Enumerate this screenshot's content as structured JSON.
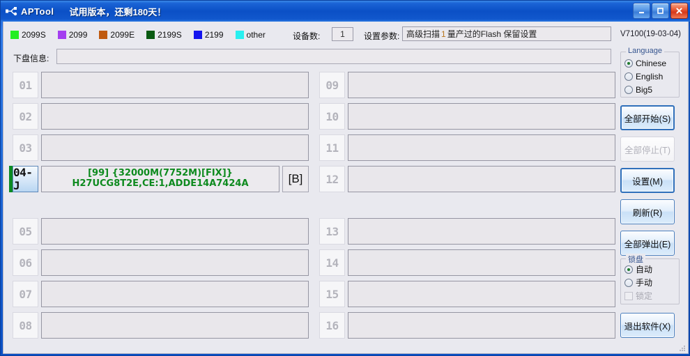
{
  "window": {
    "app_title": "APTool",
    "trial_notice": "试用版本，还剩180天！",
    "icon": "usb-device-icon",
    "buttons": {
      "minimize": "minimize-button",
      "maximize": "maximize-button",
      "close": "close-button"
    }
  },
  "legend": {
    "items": [
      {
        "label": "2099S",
        "color": "#22ee22"
      },
      {
        "label": "2099",
        "color": "#a43ef0"
      },
      {
        "label": "2099E",
        "color": "#c05a10"
      },
      {
        "label": "2199S",
        "color": "#0a5a12"
      },
      {
        "label": "2199",
        "color": "#1414ee"
      },
      {
        "label": "other",
        "color": "#28f0f0"
      }
    ]
  },
  "toolbar": {
    "device_count_label": "设备数:",
    "device_count_value": "1",
    "set_param_label": "设置参数:",
    "set_param_prefix": "高级扫描",
    "set_param_highlight": "1",
    "set_param_suffix": "量产过的Flash 保留设置",
    "version": "V7100(19-03-04)"
  },
  "info_row": {
    "label": "下盘信息:",
    "value": ""
  },
  "slots": [
    {
      "id": "01",
      "text1": "",
      "text2": "",
      "tag": "",
      "active": false
    },
    {
      "id": "02",
      "text1": "",
      "text2": "",
      "tag": "",
      "active": false
    },
    {
      "id": "03",
      "text1": "",
      "text2": "",
      "tag": "",
      "active": false
    },
    {
      "id": "04-J",
      "text1": "[99] {32000M(7752M)[FIX]}",
      "text2": "H27UCG8T2E,CE:1,ADDE14A7424A",
      "tag": "[B]",
      "active": true
    },
    {
      "id": "05",
      "text1": "",
      "text2": "",
      "tag": "",
      "active": false
    },
    {
      "id": "06",
      "text1": "",
      "text2": "",
      "tag": "",
      "active": false
    },
    {
      "id": "07",
      "text1": "",
      "text2": "",
      "tag": "",
      "active": false
    },
    {
      "id": "08",
      "text1": "",
      "text2": "",
      "tag": "",
      "active": false
    },
    {
      "id": "09",
      "text1": "",
      "text2": "",
      "tag": "",
      "active": false
    },
    {
      "id": "10",
      "text1": "",
      "text2": "",
      "tag": "",
      "active": false
    },
    {
      "id": "11",
      "text1": "",
      "text2": "",
      "tag": "",
      "active": false
    },
    {
      "id": "12",
      "text1": "",
      "text2": "",
      "tag": "",
      "active": false
    },
    {
      "id": "13",
      "text1": "",
      "text2": "",
      "tag": "",
      "active": false
    },
    {
      "id": "14",
      "text1": "",
      "text2": "",
      "tag": "",
      "active": false
    },
    {
      "id": "15",
      "text1": "",
      "text2": "",
      "tag": "",
      "active": false
    },
    {
      "id": "16",
      "text1": "",
      "text2": "",
      "tag": "",
      "active": false
    }
  ],
  "language_group": {
    "title": "Language",
    "options": [
      {
        "label": "Chinese",
        "selected": true
      },
      {
        "label": "English",
        "selected": false
      },
      {
        "label": "Big5",
        "selected": false
      }
    ]
  },
  "lock_group": {
    "title": "锁盘",
    "options": [
      {
        "label": "自动",
        "selected": true
      },
      {
        "label": "手动",
        "selected": false
      }
    ],
    "checkbox_label": "锁定",
    "checkbox_checked": false,
    "checkbox_disabled": true
  },
  "actions": {
    "start_all": "全部开始(S)",
    "stop_all": "全部停止(T)",
    "settings": "设置(M)",
    "refresh": "刷新(R)",
    "eject_all": "全部弹出(E)",
    "exit": "退出软件(X)"
  }
}
